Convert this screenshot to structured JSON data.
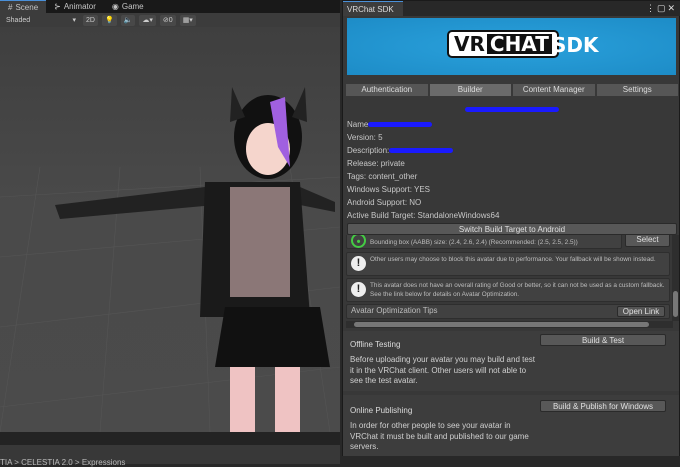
{
  "scene": {
    "tabs": [
      {
        "label": "Scene",
        "icon": "grid-icon"
      },
      {
        "label": "Animator",
        "icon": "animator-icon"
      },
      {
        "label": "Game",
        "icon": "gamepad-icon"
      }
    ],
    "toolbar": {
      "shading_mode": "Shaded",
      "mode_2d": "2D",
      "gizmo_count": "0"
    },
    "breadcrumb": "TIA > CELESTIA 2.0 > Expressions"
  },
  "sdk": {
    "window_title": "VRChat SDK",
    "banner": {
      "logo_vr": "VR",
      "logo_chat": "CHAT",
      "logo_sdk": "SDK"
    },
    "tabs": [
      "Authentication",
      "Builder",
      "Content Manager",
      "Settings"
    ],
    "active_tab": "Builder",
    "info": {
      "name_label": "Name",
      "version": "Version: 5",
      "description_label": "Description:",
      "release": "Release: private",
      "tags": "Tags: content_other",
      "windows": "Windows Support: YES",
      "android": "Android Support: NO",
      "build_target": "Active Build Target: StandaloneWindows64"
    },
    "switch_button": "Switch Build Target to Android",
    "validation": {
      "bounds_text": "Bounding box (AABB) size: (2.4, 2.6, 2.4) (Recommended: (2.5, 2.5, 2.5))",
      "select_button": "Select",
      "warning1": "Other users may choose to block this avatar due to performance. Your fallback will be shown instead.",
      "warning2": "This avatar does not have an overall rating of Good or better, so it can not be used as a custom fallback. See the link below for details on Avatar Optimization.",
      "tips_label": "Avatar Optimization Tips",
      "open_link_button": "Open Link"
    },
    "offline": {
      "title": "Offline Testing",
      "text": "Before uploading your avatar you may build and test it in the VRChat client. Other users will not able to see the test avatar.",
      "button": "Build & Test"
    },
    "online": {
      "title": "Online Publishing",
      "text": "In order for other people to see your avatar in VRChat it must be built and published to our game servers.",
      "button": "Build & Publish for Windows"
    }
  }
}
